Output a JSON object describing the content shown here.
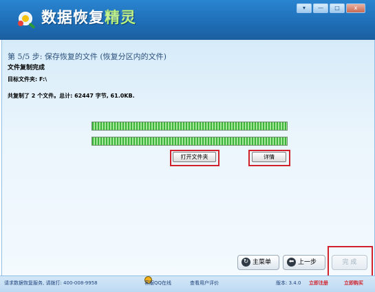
{
  "header": {
    "title_part1": "数据恢复",
    "title_part2": "精灵",
    "window_buttons": {
      "arrow": "▾",
      "minimize": "—",
      "maximize": "□",
      "close": "x"
    }
  },
  "content": {
    "step_title": "第 5/5 步: 保存恢复的文件 (恢复分区内的文件)",
    "status": "文件复制完成",
    "target": "目标文件夹: F:\\",
    "summary": "共复制了 2 个文件。总计: 62447 字节, 61.0KB.",
    "progress": [
      1.0,
      1.0
    ],
    "open_folder_label": "打开文件夹",
    "details_label": "详情"
  },
  "nav": {
    "main_menu_label": "主菜单",
    "prev_label": "上一步",
    "finish_label": "完 成"
  },
  "footer": {
    "service_text": "请求数据恢复服务, 请拨打: 400-008-9958",
    "qq_label": "客服QQ在线",
    "reviews_label": "查看用户评价",
    "version_label": "版本: 3.4.0",
    "register_label": "立即注册",
    "buy_label": "立即购买"
  },
  "colors": {
    "accent_red": "#d0202a",
    "header_blue": "#1f6fb8",
    "progress_green": "#3cb43c"
  }
}
